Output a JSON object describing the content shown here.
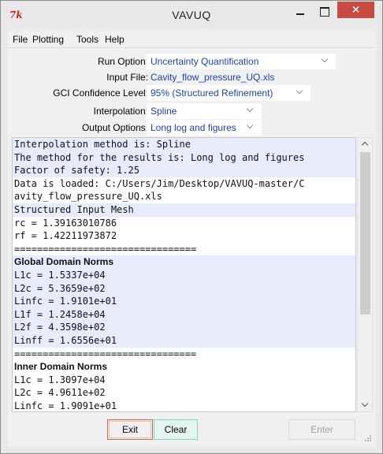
{
  "window": {
    "title": "VAVUQ",
    "icon": "vavuq-app-icon",
    "icon_text": "7k",
    "close_glyph": "✕"
  },
  "menu": [
    "File",
    "Plotting",
    "Tools",
    "Help"
  ],
  "form": {
    "run_option": {
      "label": "Run Option:",
      "value": "Uncertainty Quantification"
    },
    "input_file": {
      "label": "Input File:",
      "value": "Cavity_flow_pressure_UQ.xls"
    },
    "gci_confidence": {
      "label": "GCI Confidence Level:",
      "value": "95% (Structured Refinement)"
    },
    "interpolation": {
      "label": "Interpolation:",
      "value": "Spline"
    },
    "output_options": {
      "label": "Output Options:",
      "value": "Long log and figures"
    }
  },
  "output_lines": [
    {
      "text": "Interpolation method is: Spline",
      "hl": true,
      "bold": false
    },
    {
      "text": "The method for the results is: Long log and figures",
      "hl": true,
      "bold": false
    },
    {
      "text": "Factor of safety: 1.25",
      "hl": true,
      "bold": false
    },
    {
      "text": "Data is loaded: C:/Users/Jim/Desktop/VAVUQ-master/C",
      "hl": false,
      "bold": false
    },
    {
      "text": "avity_flow_pressure_UQ.xls",
      "hl": false,
      "bold": false
    },
    {
      "text": "Structured Input Mesh",
      "hl": true,
      "bold": false
    },
    {
      "text": "rc = 1.39163010786",
      "hl": false,
      "bold": false
    },
    {
      "text": "rf = 1.42211973872",
      "hl": false,
      "bold": false
    },
    {
      "text": "================================",
      "hl": false,
      "bold": false
    },
    {
      "text": "Global Domain Norms",
      "hl": true,
      "bold": true
    },
    {
      "text": "L1c = 1.5337e+04",
      "hl": true,
      "bold": false
    },
    {
      "text": "L2c = 5.3659e+02",
      "hl": true,
      "bold": false
    },
    {
      "text": "Linfc = 1.9101e+01",
      "hl": true,
      "bold": false
    },
    {
      "text": "L1f = 1.2458e+04",
      "hl": true,
      "bold": false
    },
    {
      "text": "L2f = 4.3598e+02",
      "hl": true,
      "bold": false
    },
    {
      "text": "Linff = 1.6556e+01",
      "hl": true,
      "bold": false
    },
    {
      "text": "================================",
      "hl": false,
      "bold": false
    },
    {
      "text": "Inner Domain Norms",
      "hl": false,
      "bold": true
    },
    {
      "text": "L1c = 1.3097e+04",
      "hl": false,
      "bold": false
    },
    {
      "text": "L2c = 4.9611e+02",
      "hl": false,
      "bold": false
    },
    {
      "text": "Linfc = 1.9091e+01",
      "hl": false,
      "bold": false
    }
  ],
  "buttons": {
    "exit": "Exit",
    "clear": "Clear",
    "enter": "Enter"
  }
}
